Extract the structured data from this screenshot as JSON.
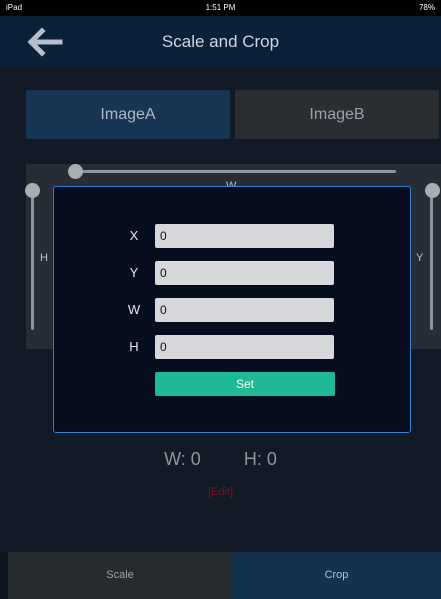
{
  "status_bar": {
    "carrier": "iPad",
    "time": "1:51 PM",
    "battery": "78%"
  },
  "nav": {
    "back_icon": "arrow-left-icon",
    "title": "Scale and Crop"
  },
  "image_buttons": [
    {
      "label": "ImageA",
      "selected": true
    },
    {
      "label": "ImageB",
      "selected": false
    }
  ],
  "editor": {
    "w_label": "W",
    "h_label": "H",
    "y_label": "Y"
  },
  "dialog": {
    "fields": [
      {
        "label": "X",
        "value": "0"
      },
      {
        "label": "Y",
        "value": "0"
      },
      {
        "label": "W",
        "value": "0"
      },
      {
        "label": "H",
        "value": "0"
      }
    ],
    "set_label": "Set"
  },
  "dimensions": {
    "w_text": "W: 0",
    "h_text": "H: 0"
  },
  "edit_link": "[Edit]",
  "tabs": [
    {
      "label": "Scale",
      "active": false
    },
    {
      "label": "Crop",
      "active": true
    }
  ],
  "colors": {
    "accent_teal": "#1fb996",
    "dialog_border": "#2f7fd2",
    "nav_bg": "#0a2238",
    "edit_red": "#7a1320"
  }
}
